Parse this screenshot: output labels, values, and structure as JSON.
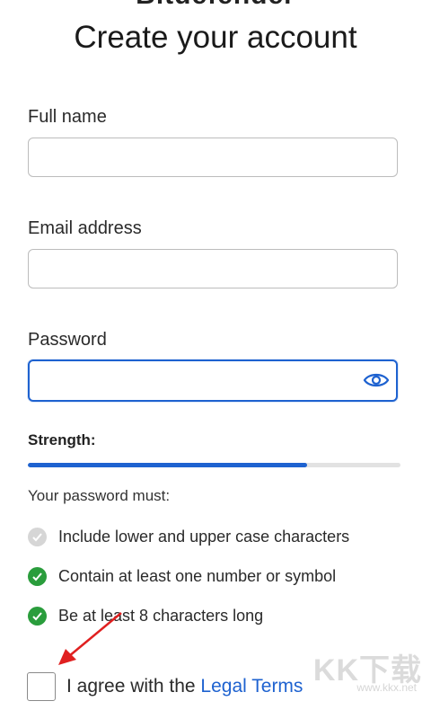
{
  "header": {
    "brand": "Bitdefender",
    "title": "Create your account"
  },
  "form": {
    "full_name": {
      "label": "Full name",
      "value": "",
      "placeholder": ""
    },
    "email": {
      "label": "Email address",
      "value": "",
      "placeholder": ""
    },
    "password": {
      "label": "Password",
      "value": "",
      "placeholder": "",
      "toggle_icon": "eye-icon"
    }
  },
  "strength": {
    "label": "Strength:",
    "level_percent": 75,
    "fill_color": "#1e62d0"
  },
  "rules": {
    "intro": "Your password must:",
    "items": [
      {
        "text": "Include lower and upper case characters",
        "met": false
      },
      {
        "text": "Contain at least one number or symbol",
        "met": true
      },
      {
        "text": "Be at least 8 characters long",
        "met": true
      }
    ]
  },
  "agreement": {
    "prefix": "I agree with the ",
    "link": "Legal Terms",
    "checked": false
  },
  "watermark": {
    "text": "KK下载",
    "url": "www.kkx.net"
  },
  "colors": {
    "accent": "#1e62d0",
    "success": "#2a9d3c",
    "pending": "#d6d6d6",
    "annotation": "#e02020"
  }
}
